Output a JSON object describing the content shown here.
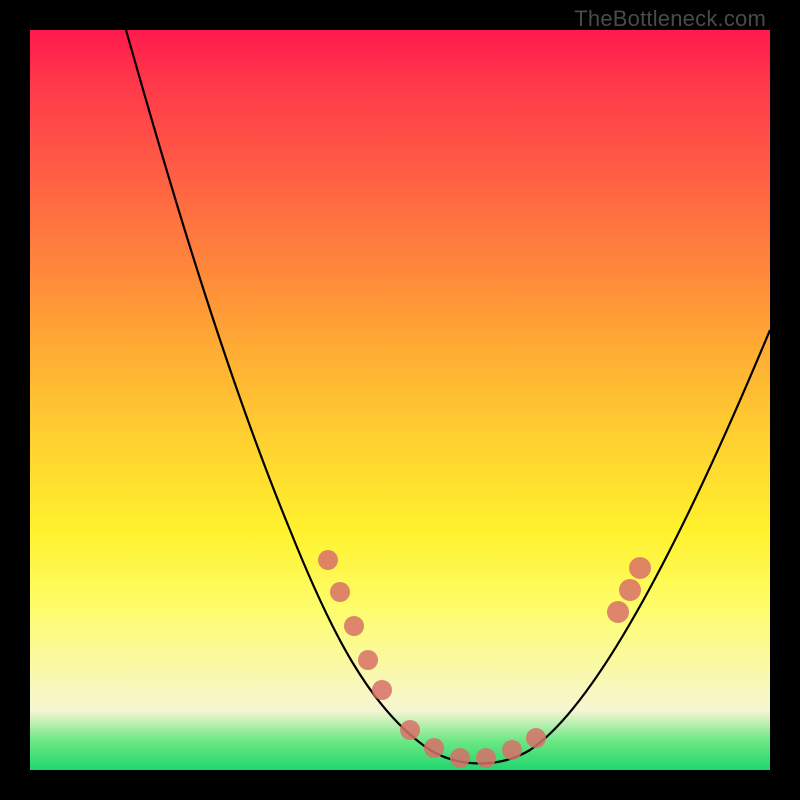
{
  "watermark": "TheBottleneck.com",
  "colors": {
    "background": "#000000",
    "curve": "#000000",
    "dots": "#d87068"
  },
  "chart_data": {
    "type": "line",
    "title": "",
    "xlabel": "",
    "ylabel": "",
    "xlim": [
      0,
      100
    ],
    "ylim": [
      0,
      100
    ],
    "grid": false,
    "legend": false,
    "note": "Axes are unlabeled; values below are normalized [0,100] read from the figure's bounding box. Curve is a V-shape; dots lie on the curve near its bottom and a cluster on the right rising limb.",
    "series": [
      {
        "name": "curve",
        "style": "line",
        "x": [
          13,
          16,
          20,
          24,
          28,
          32,
          36,
          40,
          43,
          46,
          49,
          52,
          56,
          60,
          64,
          68,
          72,
          76,
          80,
          85,
          90,
          95,
          99
        ],
        "y": [
          100,
          93,
          83,
          73,
          63,
          53,
          43,
          33,
          25,
          18,
          12,
          7,
          3,
          1,
          1,
          3,
          8,
          15,
          24,
          35,
          46,
          55,
          60
        ]
      },
      {
        "name": "dots-left-limb",
        "style": "scatter",
        "x": [
          40,
          42,
          44,
          46,
          48
        ],
        "y": [
          33,
          28,
          22,
          17,
          13
        ]
      },
      {
        "name": "dots-valley",
        "style": "scatter",
        "x": [
          52,
          55,
          58,
          61,
          64,
          67
        ],
        "y": [
          6,
          3,
          1,
          1,
          2,
          3
        ]
      },
      {
        "name": "dots-right-cluster",
        "style": "scatter",
        "x": [
          78,
          80,
          81
        ],
        "y": [
          20,
          24,
          27
        ]
      }
    ]
  }
}
